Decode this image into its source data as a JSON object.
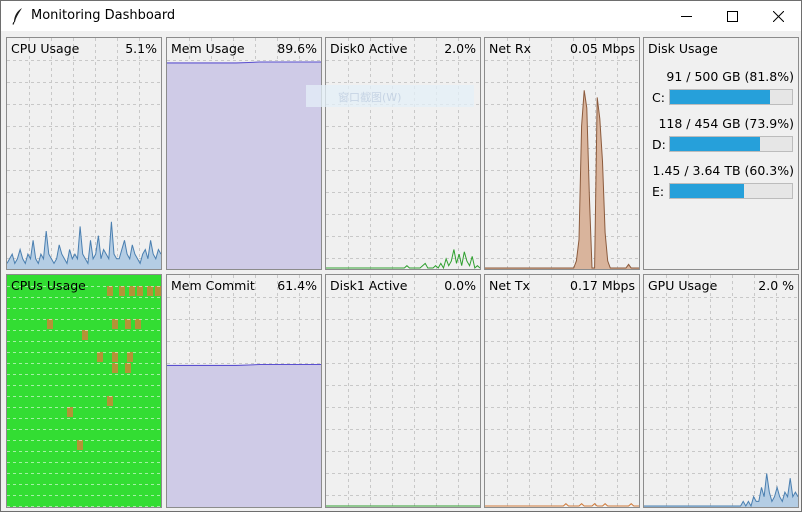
{
  "window": {
    "title": "Monitoring Dashboard",
    "icons": {
      "app": "feather-icon",
      "minimize": "minimize-icon",
      "maximize": "maximize-icon",
      "close": "close-icon"
    }
  },
  "panels": {
    "cpu": {
      "label": "CPU Usage",
      "value": "5.1%"
    },
    "mem": {
      "label": "Mem Usage",
      "value": "89.6%"
    },
    "disk0": {
      "label": "Disk0 Active",
      "value": "2.0%"
    },
    "netrx": {
      "label": "Net Rx",
      "value": "0.05 Mbps"
    },
    "cpus": {
      "label": "CPUs Usage",
      "value": ""
    },
    "memcommit": {
      "label": "Mem Commit",
      "value": "61.4%"
    },
    "disk1": {
      "label": "Disk1 Active",
      "value": "0.0%"
    },
    "nettx": {
      "label": "Net Tx",
      "value": "0.17 Mbps"
    },
    "gpu": {
      "label": "GPU Usage",
      "value": "2.0 %"
    }
  },
  "disk_usage": {
    "label": "Disk Usage",
    "drives": [
      {
        "letter": "C:",
        "text": "91 / 500 GB (81.8%)",
        "percent": 81.8
      },
      {
        "letter": "D:",
        "text": "118 / 454 GB (73.9%)",
        "percent": 73.9
      },
      {
        "letter": "E:",
        "text": "1.45 / 3.64 TB (60.3%)",
        "percent": 60.3
      }
    ]
  },
  "overlay_hint": {
    "text": "窗口截图(W)"
  },
  "colors": {
    "cpu_line": "#4a7fb0",
    "cpu_fill": "#b4cde4",
    "mem_line": "#5a4fcf",
    "mem_fill": "#cfcbe7",
    "disk_line": "#2fa02f",
    "net_line": "#8b5a3c",
    "net_fill": "#d9b49c",
    "nettx_line": "#d07a3a",
    "gpu_line": "#4a7fb0",
    "gpu_fill": "#b4cde4",
    "cpus_bg": "#33dd33",
    "cpus_hot": "#e07a3a",
    "disk_bar": "#26a0da",
    "grid": "#c8c8c8"
  },
  "series": {
    "cpu": [
      1,
      2,
      3,
      1,
      2,
      4,
      2,
      1,
      3,
      2,
      6,
      2,
      1,
      3,
      2,
      8,
      3,
      2,
      1,
      2,
      5,
      3,
      2,
      1,
      4,
      2,
      3,
      2,
      9,
      3,
      2,
      1,
      6,
      2,
      3,
      7,
      2,
      4,
      3,
      2,
      10,
      3,
      2,
      2,
      4,
      6,
      3,
      2,
      5,
      3,
      2,
      1,
      3,
      4,
      2,
      6,
      3,
      2,
      4,
      3
    ],
    "mem": 89.6,
    "memcommit": 61.4,
    "disk0": [
      0,
      0,
      0,
      0,
      0,
      0,
      0,
      0,
      0,
      0,
      0,
      0,
      0,
      0,
      0,
      0,
      0,
      0,
      0,
      0,
      0,
      0,
      0,
      0,
      0,
      0,
      0,
      0,
      0,
      0,
      0,
      1,
      0,
      0,
      0,
      0,
      0,
      1,
      2,
      0,
      0,
      0,
      1,
      0,
      2,
      0,
      4,
      1,
      3,
      8,
      2,
      6,
      1,
      7,
      3,
      1,
      5,
      0,
      1,
      0
    ],
    "netrx": [
      0,
      0,
      0,
      0,
      0,
      0,
      0,
      0,
      0,
      0,
      0,
      0,
      0,
      0,
      0,
      0,
      0,
      0,
      0,
      0,
      0,
      0,
      0,
      0,
      0,
      0,
      0,
      0,
      0,
      0,
      0,
      0,
      0,
      0,
      0,
      2,
      8,
      40,
      50,
      45,
      20,
      0,
      0,
      48,
      42,
      30,
      10,
      2,
      0,
      0,
      0,
      0,
      0,
      0,
      0,
      1,
      0,
      0,
      0,
      0
    ],
    "nettx": [
      0,
      0,
      0,
      0,
      0,
      0,
      0,
      0,
      0,
      0,
      0,
      0,
      0,
      0,
      0,
      0,
      0,
      0,
      0,
      0,
      0,
      0,
      0,
      0,
      0,
      0,
      0,
      0,
      0,
      0,
      0,
      1,
      0,
      0,
      0,
      0,
      0,
      1,
      0,
      0,
      0,
      0,
      1,
      0,
      0,
      0,
      1,
      0,
      0,
      0,
      0,
      0,
      0,
      0,
      0,
      0,
      1,
      0,
      0,
      0
    ],
    "gpu": [
      0,
      0,
      0,
      0,
      0,
      0,
      0,
      0,
      0,
      0,
      0,
      0,
      0,
      0,
      0,
      0,
      0,
      0,
      0,
      0,
      0,
      0,
      0,
      0,
      0,
      0,
      0,
      0,
      0,
      0,
      0,
      0,
      0,
      0,
      0,
      0,
      0,
      0,
      1,
      0,
      1,
      0,
      2,
      1,
      1,
      4,
      2,
      7,
      3,
      1,
      2,
      4,
      2,
      1,
      3,
      2,
      6,
      2,
      3,
      2
    ]
  }
}
